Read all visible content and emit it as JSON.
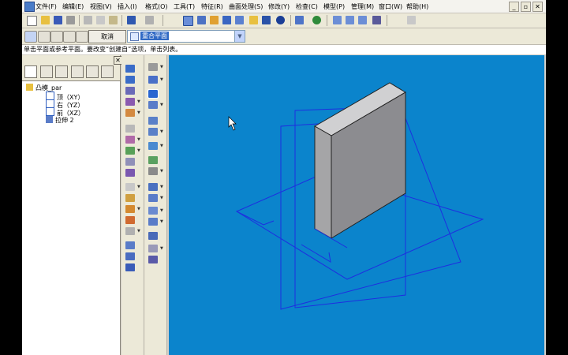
{
  "app": {
    "menu": [
      "文件(F)",
      "编辑(E)",
      "视图(V)",
      "插入(I)",
      "格式(O)",
      "工具(T)",
      "特征(R)",
      "曲面处理(S)",
      "修改(Y)",
      "检查(C)",
      "模型(P)",
      "管理(M)",
      "窗口(W)",
      "帮助(H)"
    ],
    "window_buttons": [
      "_",
      "▫",
      "✕"
    ]
  },
  "dashbar": {
    "cancel_label": "取消",
    "plane_select_value": "重合平面"
  },
  "status_message": "单击平面或参考平面。要改变“创建自”选项，单击列表。",
  "tree": {
    "root": "凸模_par",
    "nodes": [
      "顶（XY）",
      "右（YZ）",
      "前（XZ）",
      "拉伸 2"
    ]
  },
  "colors": {
    "viewport_bg": "#0b84cc",
    "plane_edge": "#1e2ee0",
    "solid_front": "#a5a5a7",
    "solid_top": "#d0d0d2",
    "solid_side": "#8c8c90"
  }
}
